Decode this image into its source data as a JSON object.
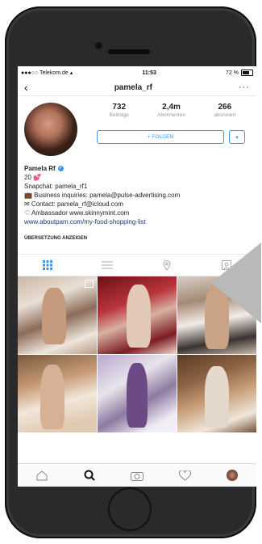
{
  "status": {
    "carrier": "●●●○○ Telekom.de",
    "time": "11:53",
    "battery": "72 %"
  },
  "nav": {
    "back_icon": "chevron-left-icon",
    "title": "pamela_rf",
    "more": "···"
  },
  "stats": [
    {
      "num": "732",
      "label": "Beiträge"
    },
    {
      "num": "2,4m",
      "label": "Abonnenten"
    },
    {
      "num": "266",
      "label": "abonniert"
    }
  ],
  "follow": {
    "label": "+ FOLGEN"
  },
  "bio": {
    "name": "Pamela Rf",
    "age": "20 💕",
    "lines": [
      "Snapchat: pamela_rf1",
      "💼 Business inquiries: pamela@pulse-advertising.com",
      "✉ Contact: pamela_rf@icloud.com",
      "♡ Ambassador www.skinnymint.com"
    ],
    "link": "www.aboutpam.com/my-food-shopping-list"
  },
  "translate": "ÜBERSETZUNG ANZEIGEN",
  "colors": {
    "accent": "#3897f0",
    "link": "#1d3a6e"
  }
}
